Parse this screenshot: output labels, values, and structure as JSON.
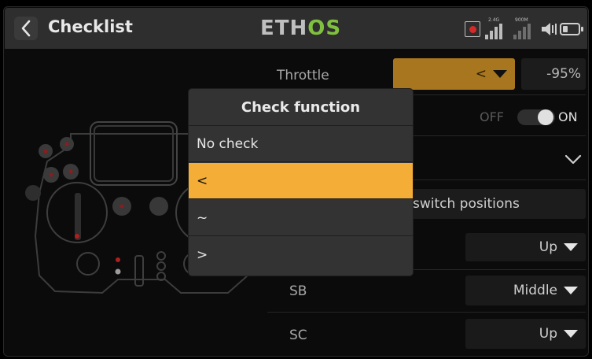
{
  "header": {
    "title": "Checklist",
    "brand_prefix": "ETH",
    "brand_suffix": "OS",
    "rx_band": "2.4G",
    "rx_band2": "900M"
  },
  "colors": {
    "accent": "#f4ad37",
    "brand_green": "#7fc13f",
    "background": "#000000",
    "header": "#2e2e2e"
  },
  "rows": {
    "throttle": {
      "label": "Throttle",
      "function_value": "<",
      "position_value": "-95%"
    },
    "toggle": {
      "off_label": "OFF",
      "on_label": "ON",
      "state": "ON"
    },
    "switch_positions_label": "switch positions",
    "switches": [
      {
        "label": "SB",
        "value": "Middle"
      },
      {
        "label": "SC",
        "value": "Up"
      }
    ],
    "top_switch_value": "Up"
  },
  "modal": {
    "title": "Check function",
    "options": [
      {
        "label": "No check",
        "selected": false
      },
      {
        "label": "<",
        "selected": true
      },
      {
        "label": "~",
        "selected": false
      },
      {
        "label": ">",
        "selected": false
      }
    ]
  },
  "icons": {
    "back": "chevron-left-icon",
    "toggle": "toggle-switch-icon",
    "expand": "chevron-down-icon",
    "dropdown": "triangle-down-icon",
    "record": "record-icon",
    "signal": "signal-bars-icon",
    "speaker": "speaker-icon",
    "battery": "battery-icon"
  }
}
